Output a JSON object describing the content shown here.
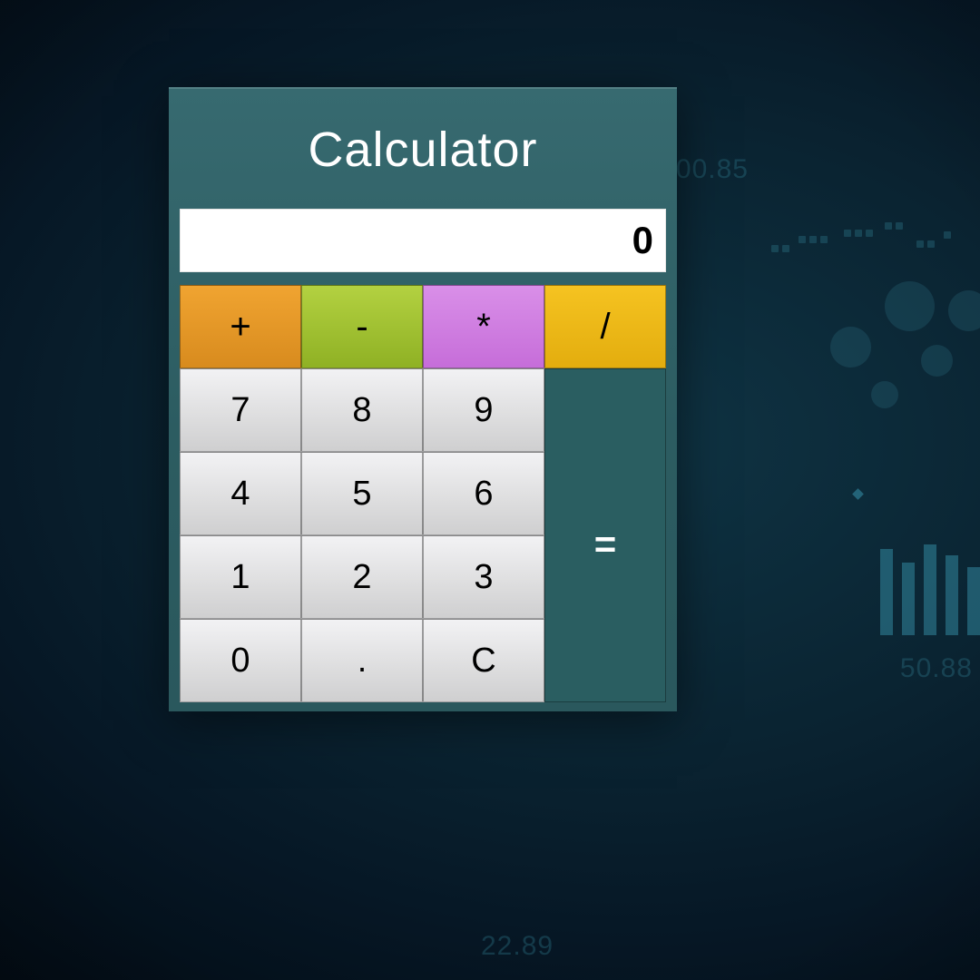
{
  "title": "Calculator",
  "display": "0",
  "operators": {
    "add": "+",
    "sub": "-",
    "mul": "*",
    "div": "/"
  },
  "keys": {
    "k7": "7",
    "k8": "8",
    "k9": "9",
    "k4": "4",
    "k5": "5",
    "k6": "6",
    "k1": "1",
    "k2": "2",
    "k3": "3",
    "k0": "0",
    "dot": ".",
    "clear": "C"
  },
  "equals": "=",
  "bg_numbers": {
    "n1": "00.85",
    "n2": "50.88",
    "n3": "22.89"
  },
  "colors": {
    "panel": "#2c5c61",
    "add": "#e3941f",
    "sub": "#9fc22f",
    "mul": "#cd7ae0",
    "div": "#ecb814",
    "num": "#e0e0e2",
    "equals": "#2a5e61"
  }
}
